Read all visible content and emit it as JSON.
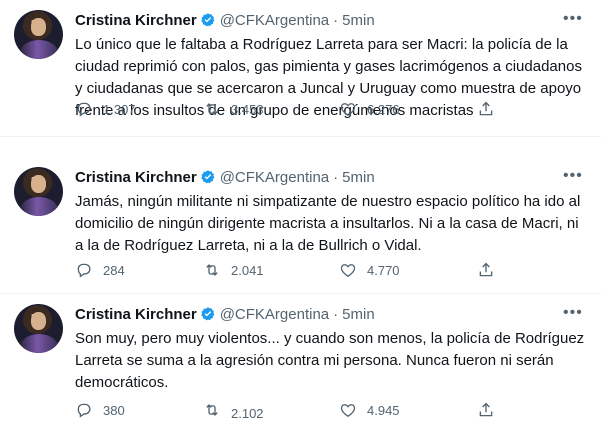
{
  "tweets": [
    {
      "name": "Cristina Kirchner",
      "handle": "@CFKArgentina",
      "separator": "·",
      "time": "5min",
      "text": "Lo único que le faltaba a Rodríguez Larreta para ser Macri: la policía de la ciudad reprimió con palos, gas pimienta y gases lacrimógenos a ciudadanos y ciudadanas que se acercaron a Juncal y Uruguay como muestra de apoyo frente a los insultos de un grupo de energúmenos macristas",
      "replies": "1.307",
      "retweets": "3.453",
      "likes": "6.276",
      "more_icon": "more-icon",
      "verified_icon": "verified-icon"
    },
    {
      "name": "Cristina Kirchner",
      "handle": "@CFKArgentina",
      "separator": "·",
      "time": "5min",
      "text": "Jamás, ningún militante ni simpatizante de nuestro espacio político ha ido al domicilio de ningún dirigente macrista a insultarlos. Ni a la casa de Macri, ni a la de Rodríguez Larreta, ni a la de Bullrich o Vidal.",
      "replies": "284",
      "retweets": "2.041",
      "likes": "4.770",
      "more_icon": "more-icon",
      "verified_icon": "verified-icon"
    },
    {
      "name": "Cristina Kirchner",
      "handle": "@CFKArgentina",
      "separator": "·",
      "time": "5min",
      "text": "Son muy, pero muy violentos... y cuando son menos, la policía de Rodríguez Larreta se suma a la agresión contra mi persona. Nunca fueron ni serán democráticos.",
      "replies": "380",
      "retweets": "2.102",
      "likes": "4.945",
      "more_icon": "more-icon",
      "verified_icon": "verified-icon"
    }
  ],
  "colors": {
    "verified": "#1d9bf0",
    "secondary_text": "#536471",
    "primary_text": "#0f1419",
    "divider": "#eff3f4"
  }
}
